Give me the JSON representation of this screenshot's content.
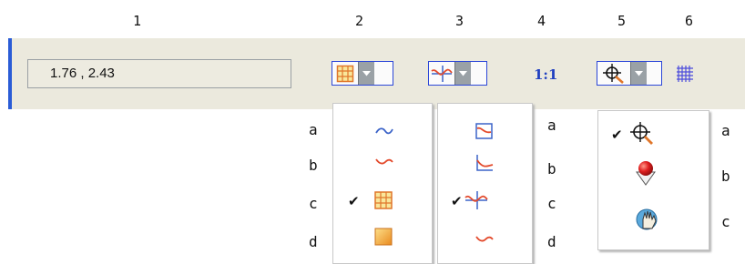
{
  "column_numbers": [
    "1",
    "2",
    "3",
    "4",
    "5",
    "6"
  ],
  "coordinates": "1.76 , 2.43",
  "aspect_label": "1:1",
  "row_letters": [
    "a",
    "b",
    "c",
    "d"
  ],
  "menu1_checked": "c",
  "menu2_checked": "c",
  "menu3_checked": "a",
  "check_mark": "✔",
  "menu3_letters": [
    "a",
    "b",
    "c"
  ],
  "colors": {
    "accent": "#2a5cd6",
    "toolbar_bg": "#ebe9dd",
    "curve_blue": "#3b63c8",
    "curve_red": "#e34a2c"
  }
}
